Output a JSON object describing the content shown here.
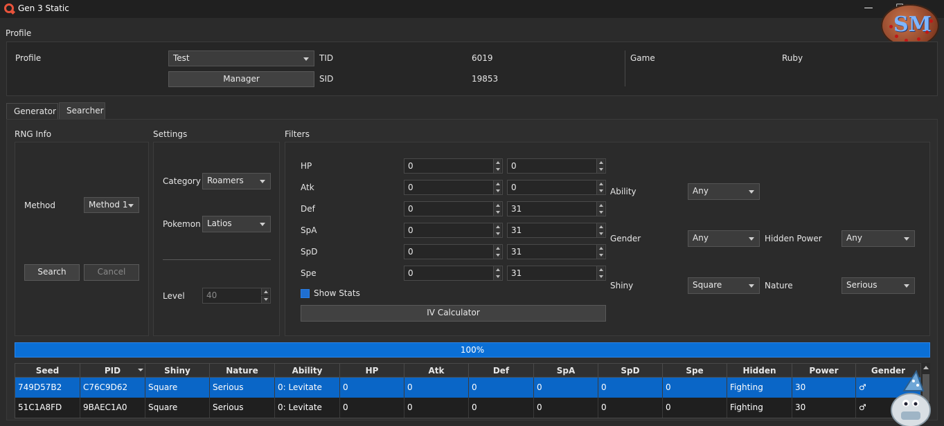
{
  "window": {
    "title": "Gen 3 Static"
  },
  "profile": {
    "section_label": "Profile",
    "profile_label": "Profile",
    "profile_value": "Test",
    "manager_button": "Manager",
    "tid_label": "TID",
    "tid_value": "6019",
    "sid_label": "SID",
    "sid_value": "19853",
    "game_label": "Game",
    "game_value": "Ruby"
  },
  "tabs": [
    {
      "label": "Generator"
    },
    {
      "label": "Searcher"
    }
  ],
  "rng": {
    "section_label": "RNG Info",
    "method_label": "Method",
    "method_value": "Method 1",
    "search_button": "Search",
    "cancel_button": "Cancel"
  },
  "settings": {
    "section_label": "Settings",
    "category_label": "Category",
    "category_value": "Roamers",
    "pokemon_label": "Pokemon",
    "pokemon_value": "Latios",
    "level_label": "Level",
    "level_value": "40"
  },
  "filters": {
    "section_label": "Filters",
    "stats": [
      {
        "label": "HP",
        "min": "0",
        "max": "0"
      },
      {
        "label": "Atk",
        "min": "0",
        "max": "0"
      },
      {
        "label": "Def",
        "min": "0",
        "max": "31"
      },
      {
        "label": "SpA",
        "min": "0",
        "max": "31"
      },
      {
        "label": "SpD",
        "min": "0",
        "max": "31"
      },
      {
        "label": "Spe",
        "min": "0",
        "max": "31"
      }
    ],
    "show_stats_label": "Show Stats",
    "iv_calc_button": "IV Calculator",
    "ability_label": "Ability",
    "ability_value": "Any",
    "gender_label": "Gender",
    "gender_value": "Any",
    "hidden_power_label": "Hidden Power",
    "hidden_power_value": "Any",
    "shiny_label": "Shiny",
    "shiny_value": "Square",
    "nature_label": "Nature",
    "nature_value": "Serious"
  },
  "progress": {
    "text": "100%",
    "value": 1.0
  },
  "table": {
    "headers": [
      "Seed",
      "PID",
      "Shiny",
      "Nature",
      "Ability",
      "HP",
      "Atk",
      "Def",
      "SpA",
      "SpD",
      "Spe",
      "Hidden",
      "Power",
      "Gender"
    ],
    "rows": [
      [
        "749D57B2",
        "C76C9D62",
        "Square",
        "Serious",
        "0: Levitate",
        "0",
        "0",
        "0",
        "0",
        "0",
        "0",
        "Fighting",
        "30",
        "♂"
      ],
      [
        "51C1A8FD",
        "9BAEC1A0",
        "Square",
        "Serious",
        "0: Levitate",
        "0",
        "0",
        "0",
        "0",
        "0",
        "0",
        "Fighting",
        "30",
        "♂"
      ]
    ]
  },
  "colors": {
    "accent": "#0a6fd6",
    "selection": "#0a66c7",
    "app_icon": "#e8533b"
  },
  "icons": {
    "app": "app-logo-icon",
    "logo": "sm-ball-logo",
    "mascot": "mascot-sticker"
  }
}
